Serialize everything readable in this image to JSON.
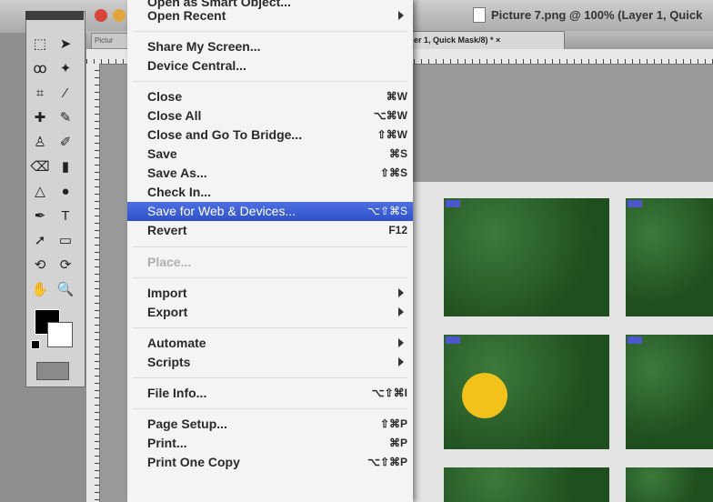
{
  "window": {
    "title": "Picture 7.png @ 100% (Layer 1, Quick",
    "tab_left": "Pictur",
    "tab_active": "er 1, Quick Mask/8) * ×"
  },
  "menu": {
    "items": [
      {
        "label": "Open as Smart Object...",
        "shortcut": "",
        "submenu": false
      },
      {
        "label": "Open Recent",
        "shortcut": "",
        "submenu": true
      },
      {
        "label": "Share My Screen...",
        "shortcut": "",
        "submenu": false
      },
      {
        "label": "Device Central...",
        "shortcut": "",
        "submenu": false
      },
      {
        "label": "Close",
        "shortcut": "⌘W",
        "submenu": false
      },
      {
        "label": "Close All",
        "shortcut": "⌥⌘W",
        "submenu": false
      },
      {
        "label": "Close and Go To Bridge...",
        "shortcut": "⇧⌘W",
        "submenu": false
      },
      {
        "label": "Save",
        "shortcut": "⌘S",
        "submenu": false
      },
      {
        "label": "Save As...",
        "shortcut": "⇧⌘S",
        "submenu": false
      },
      {
        "label": "Check In...",
        "shortcut": "",
        "submenu": false
      },
      {
        "label": "Save for Web & Devices...",
        "shortcut": "⌥⇧⌘S",
        "submenu": false,
        "highlighted": true
      },
      {
        "label": "Revert",
        "shortcut": "F12",
        "submenu": false
      },
      {
        "label": "Place...",
        "shortcut": "",
        "submenu": false,
        "disabled": true
      },
      {
        "label": "Import",
        "shortcut": "",
        "submenu": true
      },
      {
        "label": "Export",
        "shortcut": "",
        "submenu": true
      },
      {
        "label": "Automate",
        "shortcut": "",
        "submenu": true
      },
      {
        "label": "Scripts",
        "shortcut": "",
        "submenu": true
      },
      {
        "label": "File Info...",
        "shortcut": "⌥⇧⌘I",
        "submenu": false
      },
      {
        "label": "Page Setup...",
        "shortcut": "⇧⌘P",
        "submenu": false
      },
      {
        "label": "Print...",
        "shortcut": "⌘P",
        "submenu": false
      },
      {
        "label": "Print One Copy",
        "shortcut": "⌥⇧⌘P",
        "submenu": false
      }
    ]
  },
  "toolbox": {
    "tools": [
      "marquee-tool",
      "move-tool",
      "lasso-tool",
      "magic-wand-tool",
      "crop-tool",
      "eyedropper-tool",
      "healing-brush-tool",
      "brush-tool",
      "clone-stamp-tool",
      "history-brush-tool",
      "eraser-tool",
      "gradient-tool",
      "blur-tool",
      "dodge-tool",
      "pen-tool",
      "type-tool",
      "path-selection-tool",
      "shape-tool",
      "3d-rotate-tool",
      "3d-orbit-tool",
      "hand-tool",
      "zoom-tool"
    ],
    "glyphs": [
      "⬚",
      "➤",
      "ꝏ",
      "✦",
      "⌗",
      "⁄",
      "✚",
      "✎",
      "♙",
      "✐",
      "⌫",
      "▮",
      "△",
      "●",
      "✒",
      "T",
      "➚",
      "▭",
      "⟲",
      "⟳",
      "✋",
      "🔍"
    ]
  },
  "colors": {
    "menu_highlight": "#3a5ed6",
    "foreground": "#000000",
    "background": "#ffffff",
    "slice_label": "#4c57c9"
  }
}
